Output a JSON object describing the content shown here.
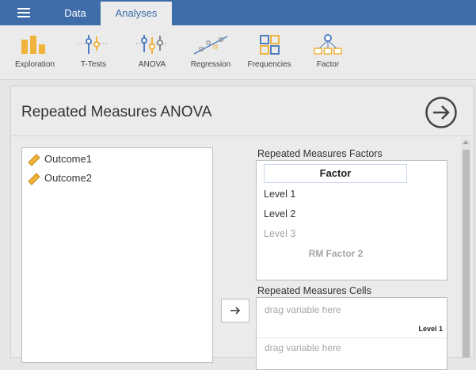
{
  "tabs": {
    "data": "Data",
    "analyses": "Analyses"
  },
  "ribbon": [
    {
      "label": "Exploration",
      "icon": "exploration-icon"
    },
    {
      "label": "T-Tests",
      "icon": "t-tests-icon"
    },
    {
      "label": "ANOVA",
      "icon": "anova-icon"
    },
    {
      "label": "Regression",
      "icon": "regression-icon"
    },
    {
      "label": "Frequencies",
      "icon": "frequencies-icon"
    },
    {
      "label": "Factor",
      "icon": "factor-icon"
    }
  ],
  "panel": {
    "title": "Repeated Measures ANOVA"
  },
  "variables": [
    "Outcome1",
    "Outcome2"
  ],
  "rm_factors": {
    "label": "Repeated Measures Factors",
    "factor_name": "Factor",
    "levels": [
      "Level 1",
      "Level 2"
    ],
    "level_placeholder": "Level 3",
    "add_factor_placeholder": "RM Factor 2"
  },
  "rm_cells": {
    "label": "Repeated Measures Cells",
    "placeholder_1": "drag variable here",
    "level_label": "Level 1",
    "placeholder_2": "drag variable here"
  },
  "colors": {
    "brand": "#3e6da9",
    "accent": "#f0b43c",
    "icon_blue": "#4f7ec0"
  }
}
